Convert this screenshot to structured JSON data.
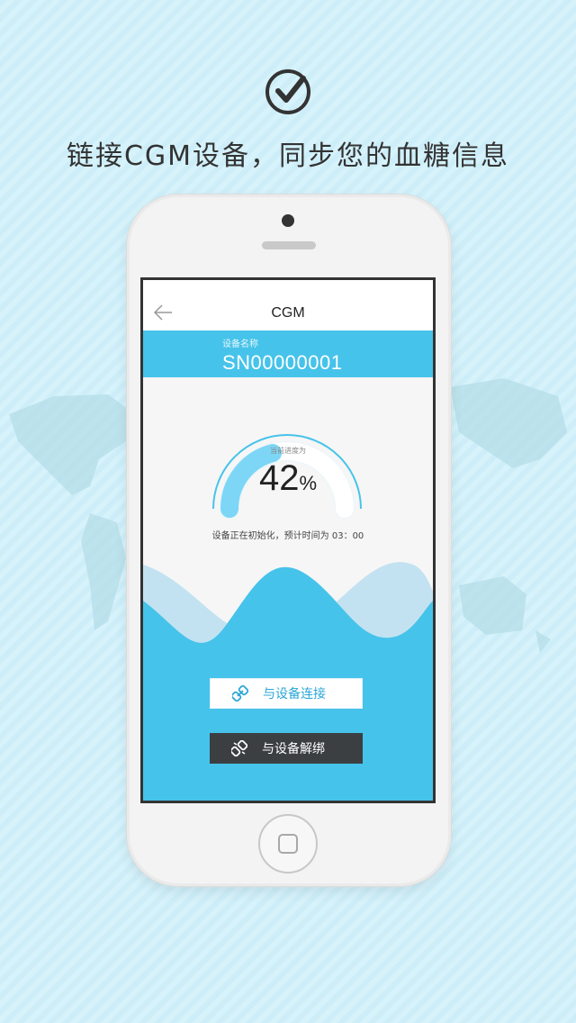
{
  "promo": {
    "headline": "链接CGM设备，同步您的血糖信息"
  },
  "screen": {
    "nav": {
      "title": "CGM"
    },
    "device": {
      "name_label": "设备名称",
      "serial": "SN00000001"
    },
    "progress": {
      "label": "当前进度为",
      "value": "42",
      "unit": "%",
      "fraction": 0.42,
      "status": "设备正在初始化，预计时间为 03：00"
    },
    "actions": {
      "connect_label": "与设备连接",
      "unbind_label": "与设备解绑"
    }
  },
  "icons": {
    "check": "check-circle-icon",
    "back": "arrow-left-icon",
    "connect": "link-icon",
    "unbind": "broken-link-icon"
  },
  "colors": {
    "accent": "#46c3ea",
    "dark_button": "#3b3f42",
    "background": "#cdeef8"
  }
}
